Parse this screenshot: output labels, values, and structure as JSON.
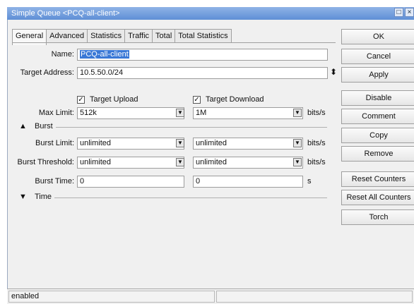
{
  "window": {
    "title": "Simple Queue <PCQ-all-client>",
    "restore_glyph": "□",
    "close_glyph": "×"
  },
  "tabs": [
    "General",
    "Advanced",
    "Statistics",
    "Traffic",
    "Total",
    "Total Statistics"
  ],
  "form": {
    "name_label": "Name:",
    "name_value": "PCQ-all-client",
    "target_address_label": "Target Address:",
    "target_address_value": "10.5.50.0/24",
    "target_upload_label": "Target Upload",
    "target_upload_checked": true,
    "target_download_label": "Target Download",
    "target_download_checked": true,
    "max_limit_label": "Max Limit:",
    "max_limit_upload": "512k",
    "max_limit_download": "1M",
    "unit_bits": "bits/s",
    "unit_s": "s",
    "burst_section": "Burst",
    "burst_limit_label": "Burst Limit:",
    "burst_limit_upload": "unlimited",
    "burst_limit_download": "unlimited",
    "burst_threshold_label": "Burst Threshold:",
    "burst_threshold_upload": "unlimited",
    "burst_threshold_download": "unlimited",
    "burst_time_label": "Burst Time:",
    "burst_time_upload": "0",
    "burst_time_download": "0",
    "time_section": "Time"
  },
  "buttons": {
    "ok": "OK",
    "cancel": "Cancel",
    "apply": "Apply",
    "disable": "Disable",
    "comment": "Comment",
    "copy": "Copy",
    "remove": "Remove",
    "reset_counters": "Reset Counters",
    "reset_all_counters": "Reset All Counters",
    "torch": "Torch"
  },
  "status": {
    "text": "enabled"
  },
  "icons": {
    "dropdown": "▼",
    "updown": "⬍",
    "check": "✓",
    "collapse": "▲",
    "expand": "▼"
  }
}
